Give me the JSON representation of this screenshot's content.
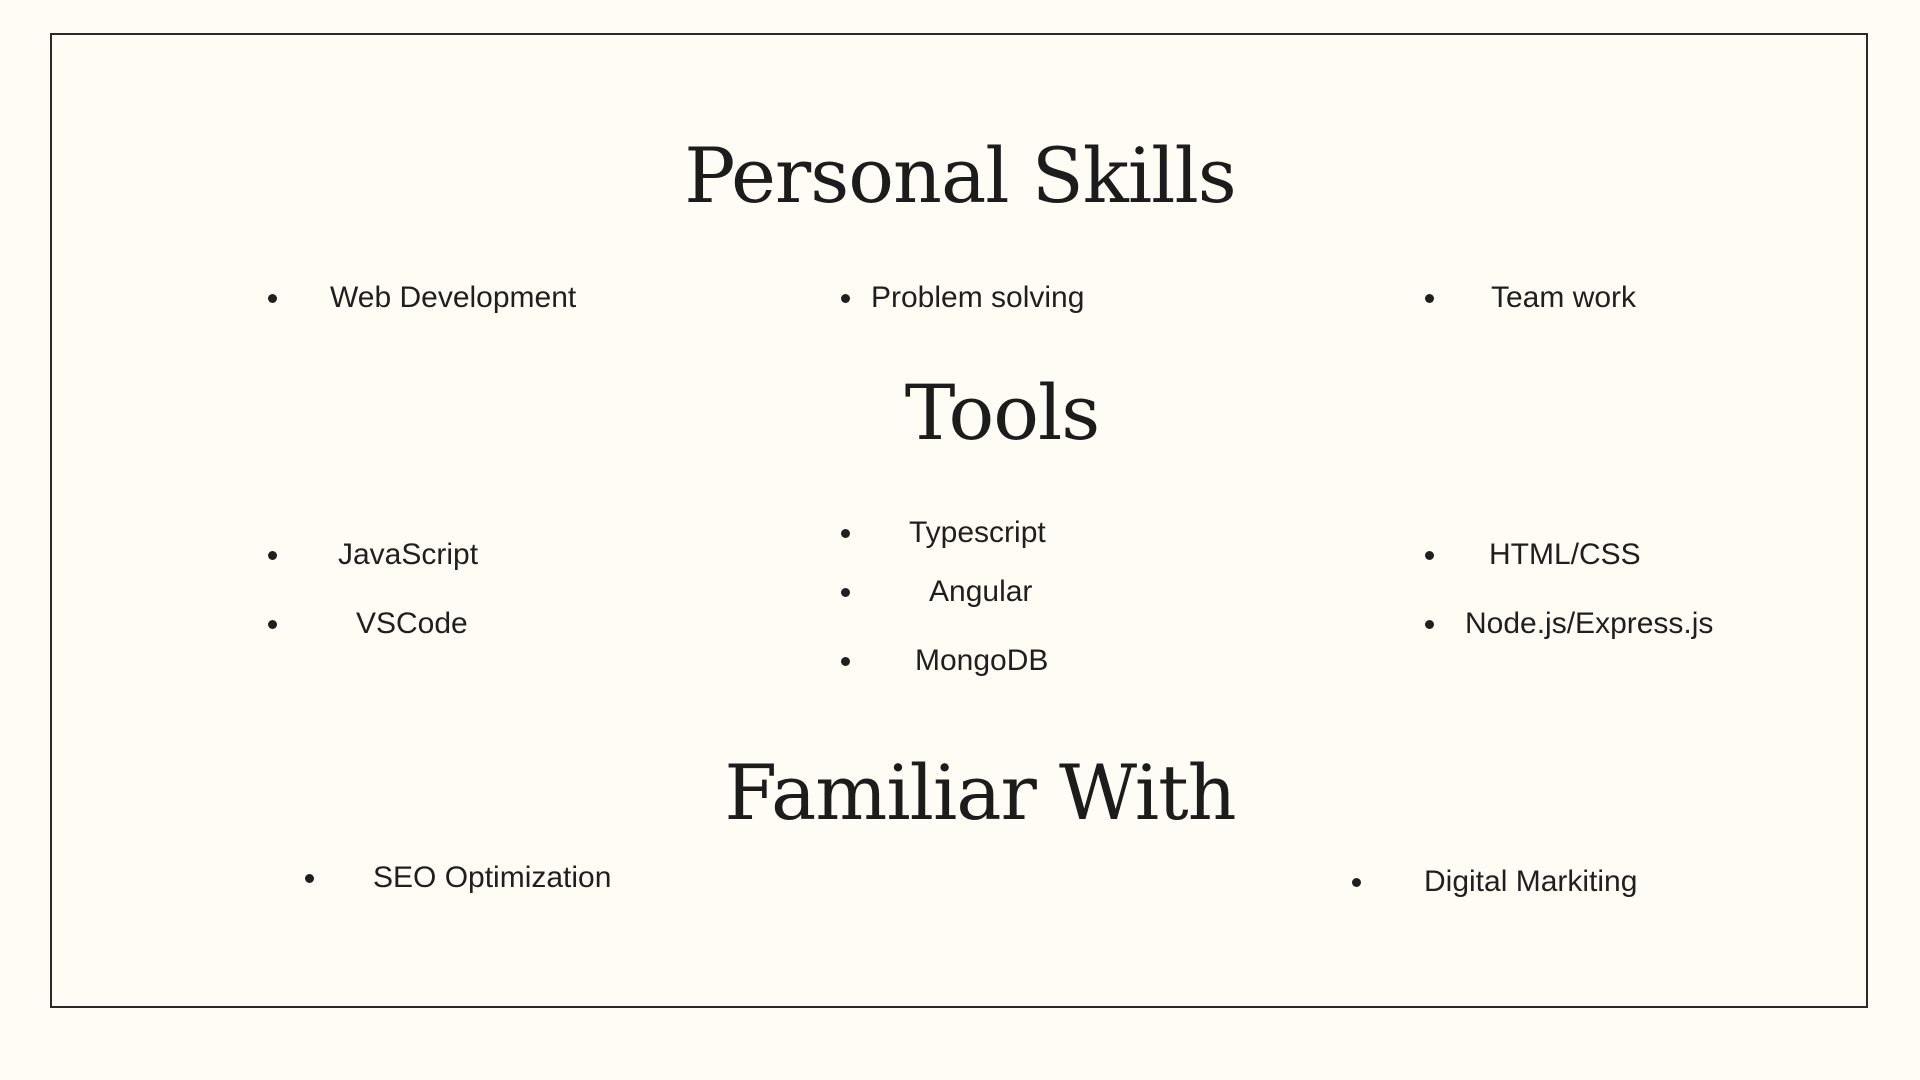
{
  "sections": {
    "personal_skills": {
      "title": "Personal Skills",
      "items": [
        "Web Development",
        "Problem solving",
        "Team work"
      ]
    },
    "tools": {
      "title": "Tools",
      "items": [
        "JavaScript",
        "VSCode",
        "Typescript",
        "Angular",
        "MongoDB",
        "HTML/CSS",
        "Node.js/Express.js"
      ]
    },
    "familiar_with": {
      "title": "Familiar With",
      "items": [
        "SEO Optimization",
        "Digital Markiting"
      ]
    }
  }
}
